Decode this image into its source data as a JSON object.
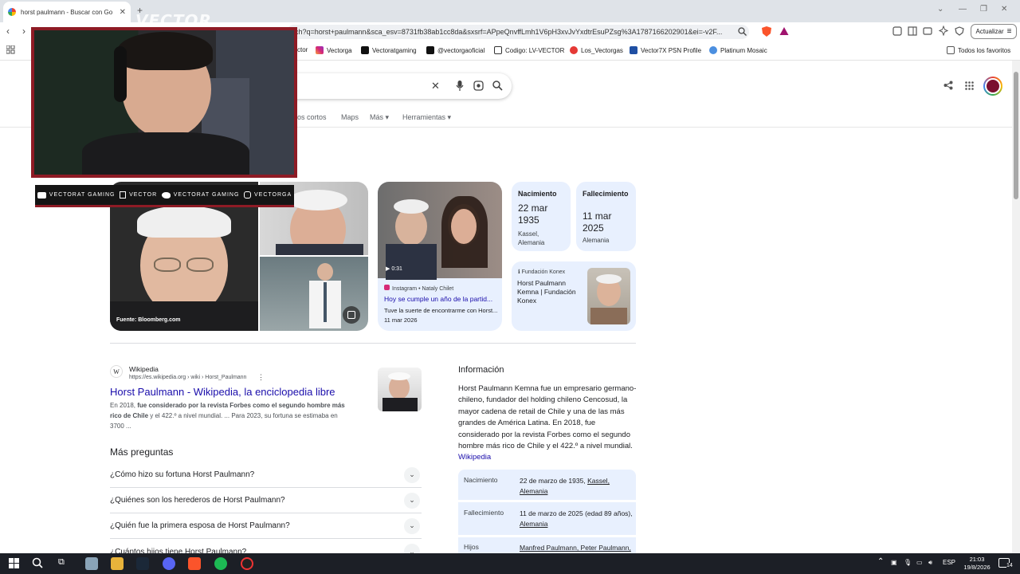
{
  "browser": {
    "tab_title": "horst paulmann - Buscar con Go",
    "url": "ch?q=horst+paulmann&sca_esv=8731fb38ab1cc8da&sxsrf=APpeQnvffLmh1V6pH3xvJvYxdtrEsuPZsg%3A1787166202901&ei=-v2F...",
    "update_label": "Actualizar",
    "bookmarks": [
      "ctor",
      "Vectorga",
      "Vectoratgaming",
      "@vectorgaoficial",
      "Codigo: LV-VECTOR",
      "Los_Vectorgas",
      "Vector7X PSN Profile",
      "Platinum Mosaic"
    ],
    "all_favorites": "Todos los favoritos"
  },
  "google": {
    "nav_tabs": [
      "eos cortos",
      "Maps",
      "Más",
      "Herramientas"
    ],
    "image_source": "Fuente: Bloomberg.com",
    "video": {
      "duration": "0:31",
      "source": "Instagram • Nataly Chilet",
      "title": "Hoy se cumple un año de la partid...",
      "snippet": "Tuve la suerte de encontrarme con Horst...",
      "date": "11 mar 2026"
    },
    "birth_card": {
      "label": "Nacimiento",
      "date1": "22 mar",
      "date2": "1935",
      "place1": "Kassel,",
      "place2": "Alemania"
    },
    "death_card": {
      "label": "Fallecimiento",
      "date1": "11 mar",
      "date2": "2025",
      "place": "Alemania"
    },
    "konex_card": {
      "source": "Fundación Konex",
      "line1": "Horst Paulmann",
      "line2": "Kemna | Fundación",
      "line3": "Konex"
    },
    "result": {
      "site": "Wikipedia",
      "url": "https://es.wikipedia.org › wiki › Horst_Paulmann",
      "title": "Horst Paulmann - Wikipedia, la enciclopedia libre",
      "snippet_pre": "En 2018, ",
      "snippet_bold": "fue considerado por la revista Forbes como el segundo hombre más",
      "snippet_line2_bold": "rico de Chile",
      "snippet_line2_rest": " y el 422.º a nivel mundial. ... Para 2023, su fortuna se estimaba en",
      "snippet_line3": "3700 ..."
    },
    "paa_title": "Más preguntas",
    "questions": [
      "¿Cómo hizo su fortuna Horst Paulmann?",
      "¿Quiénes son los herederos de Horst Paulmann?",
      "¿Quién fue la primera esposa de Horst Paulmann?",
      "¿Cuántos hijos tiene Horst Paulmann?"
    ],
    "info": {
      "title": "Información",
      "description": "Horst Paulmann Kemna  fue un empresario germano-chileno, fundador del holding chileno Cencosud, la mayor cadena de retail de Chile y una de las más grandes de América Latina. En 2018, fue considerado por la revista Forbes como el segundo hombre más rico de Chile y el 422.º a nivel mundial.",
      "source_link": "Wikipedia",
      "rows": [
        {
          "k": "Nacimiento",
          "v1": "22 de marzo de 1935, ",
          "v1u": "Kassel,",
          "v2u": "Alemania"
        },
        {
          "k": "Fallecimiento",
          "v1": "11 de marzo de 2025 (edad 89 años),",
          "v1u": "",
          "v2u": "Alemania"
        },
        {
          "k": "Hijos",
          "v1": "",
          "v1u": "Manfred Paulmann, Peter Paulmann,",
          "v2u": ""
        }
      ]
    }
  },
  "overlay": {
    "brand": "VECTOR",
    "social": [
      "VECTORAT GAMING",
      "VECTOR",
      "VECTORAT GAMING",
      "VECTORGA"
    ]
  },
  "taskbar": {
    "lang": "ESP",
    "time": "21:03",
    "date": "19/8/2026",
    "notif": "14"
  }
}
